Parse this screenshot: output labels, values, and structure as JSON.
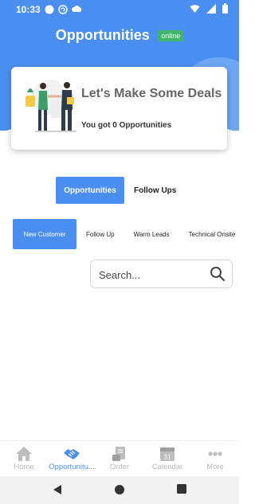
{
  "status_bar": {
    "time": "10:33",
    "icons": [
      "circle-icon",
      "sync-icon",
      "cloud-icon",
      "wifi-icon",
      "signal-icon",
      "battery-icon"
    ]
  },
  "header": {
    "title": "Opportunities",
    "badge": "online"
  },
  "card": {
    "heading": "Let's Make Some Deals",
    "subtitle": "You got 0 Opportunities",
    "illustration": "handshake-illustration"
  },
  "main_tabs": [
    {
      "label": "Opportunities",
      "active": true
    },
    {
      "label": "Follow Ups",
      "active": false
    }
  ],
  "sub_tabs": [
    {
      "label": "New Customer",
      "active": true
    },
    {
      "label": "Follow Up",
      "active": false
    },
    {
      "label": "Warm Leads",
      "active": false
    },
    {
      "label": "Technical Onsite",
      "active": false
    }
  ],
  "search": {
    "placeholder": "Search...",
    "value": "",
    "icon": "search-icon"
  },
  "bottom_nav": [
    {
      "label": "Home",
      "icon": "home-icon",
      "active": false
    },
    {
      "label": "Opportunitu...",
      "icon": "handshake-icon",
      "active": true
    },
    {
      "label": "Order",
      "icon": "order-icon",
      "active": false
    },
    {
      "label": "Calendar",
      "icon": "calendar-icon",
      "active": false
    },
    {
      "label": "More",
      "icon": "more-icon",
      "active": false
    }
  ],
  "calendar_icon_day": "31",
  "colors": {
    "primary": "#4a8ff0",
    "online_badge": "#3fb56a",
    "inactive_nav": "#b9b9b9"
  }
}
